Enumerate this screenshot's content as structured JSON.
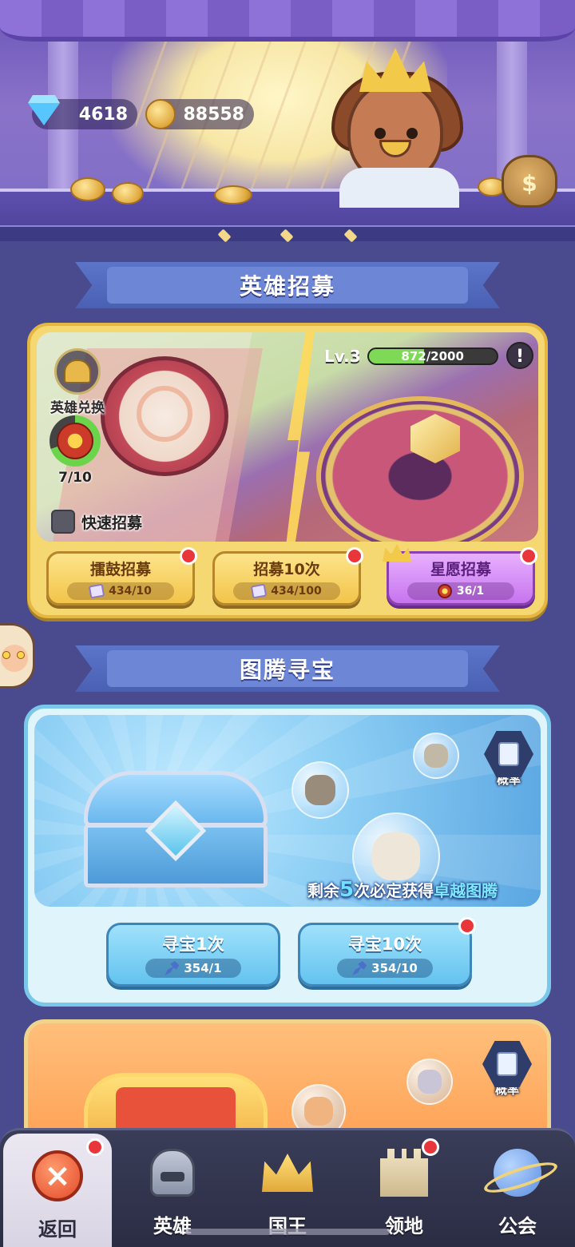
{
  "currencies": {
    "gems": "4618",
    "gold": "88558"
  },
  "hero_recruit": {
    "title": "英雄招募",
    "hero_exchange_label": "英雄兑换",
    "token_progress": "7/10",
    "token_progress_fraction": 0.7,
    "quick_recruit_label": "快速招募",
    "level_label": "Lv.3",
    "exp_text": "872/2000",
    "exp_fraction": 0.436,
    "info_symbol": "!",
    "buttons": [
      {
        "label": "擂鼓招募",
        "cost": "434/10",
        "icon": "scroll-icon"
      },
      {
        "label": "招募10次",
        "cost": "434/100",
        "icon": "scroll-icon"
      },
      {
        "label": "星愿招募",
        "cost": "36/1",
        "icon": "star-token-icon"
      }
    ]
  },
  "totem_treasure": {
    "title": "图腾寻宝",
    "probability_label": "概率",
    "guarantee_prefix": "剩余",
    "guarantee_count": "5",
    "guarantee_mid": "次必定获得",
    "guarantee_item": "卓越图腾",
    "buttons": [
      {
        "label": "寻宝1次",
        "cost": "354/1",
        "icon": "shovel-icon"
      },
      {
        "label": "寻宝10次",
        "cost": "354/10",
        "icon": "shovel-icon"
      }
    ]
  },
  "second_treasure": {
    "probability_label": "概率"
  },
  "bottom_nav": {
    "items": [
      {
        "label": "返回",
        "icon": "close-icon",
        "active": true,
        "badge": true
      },
      {
        "label": "英雄",
        "icon": "helmet-icon",
        "active": false,
        "badge": false
      },
      {
        "label": "国王",
        "icon": "crown-icon",
        "active": false,
        "badge": false
      },
      {
        "label": "领地",
        "icon": "castle-icon",
        "active": false,
        "badge": true
      },
      {
        "label": "公会",
        "icon": "planet-icon",
        "active": false,
        "badge": false
      }
    ]
  },
  "colors": {
    "background": "#4a4a8e",
    "recruit_card": "#f5d871",
    "totem_card": "#dff5fb",
    "badge_red": "#e8363a",
    "exp_fill": "#7ed957"
  }
}
